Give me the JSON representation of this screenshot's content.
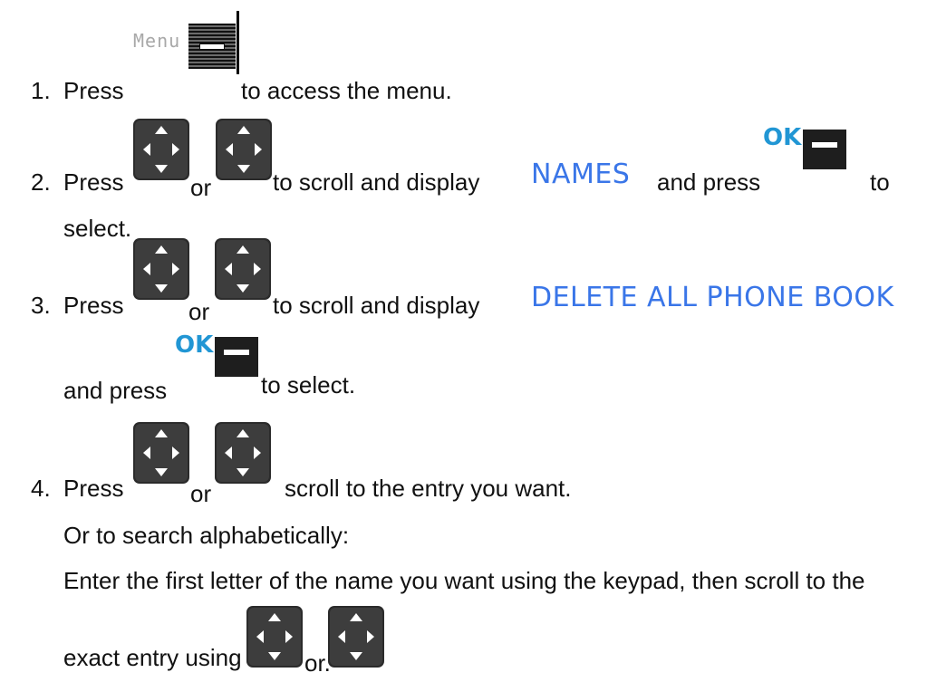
{
  "colors": {
    "highlight": "#3A76E8",
    "ok_label": "#2196D4"
  },
  "icons": {
    "menu_key": "menu-softkey-icon",
    "nav_up": "nav-up-icon",
    "nav_down": "nav-down-icon",
    "ok_key": "ok-softkey-icon"
  },
  "step1": {
    "number": "1.",
    "press": "Press",
    "menu_label": "Menu",
    "rest": "to access the menu."
  },
  "step2": {
    "number": "2.",
    "press": "Press",
    "or": "or",
    "middle": "to scroll and display",
    "target": "NAMES",
    "and_press": "and press",
    "ok_label": "OK",
    "to": "to",
    "select": "select."
  },
  "step3": {
    "number": "3.",
    "press": "Press",
    "or": "or",
    "middle": "to scroll and display",
    "target": "DELETE ALL PHONE BOOK",
    "and_press": "and press",
    "ok_label": "OK",
    "to_select": "to select."
  },
  "step4": {
    "number": "4.",
    "press": "Press",
    "or": "or",
    "rest": "scroll to the entry you want.",
    "alt": "Or to search alphabetically:",
    "instruction": "Enter the first letter of the name you want using the keypad, then scroll to the",
    "exact": "exact entry using",
    "or2": "or."
  }
}
